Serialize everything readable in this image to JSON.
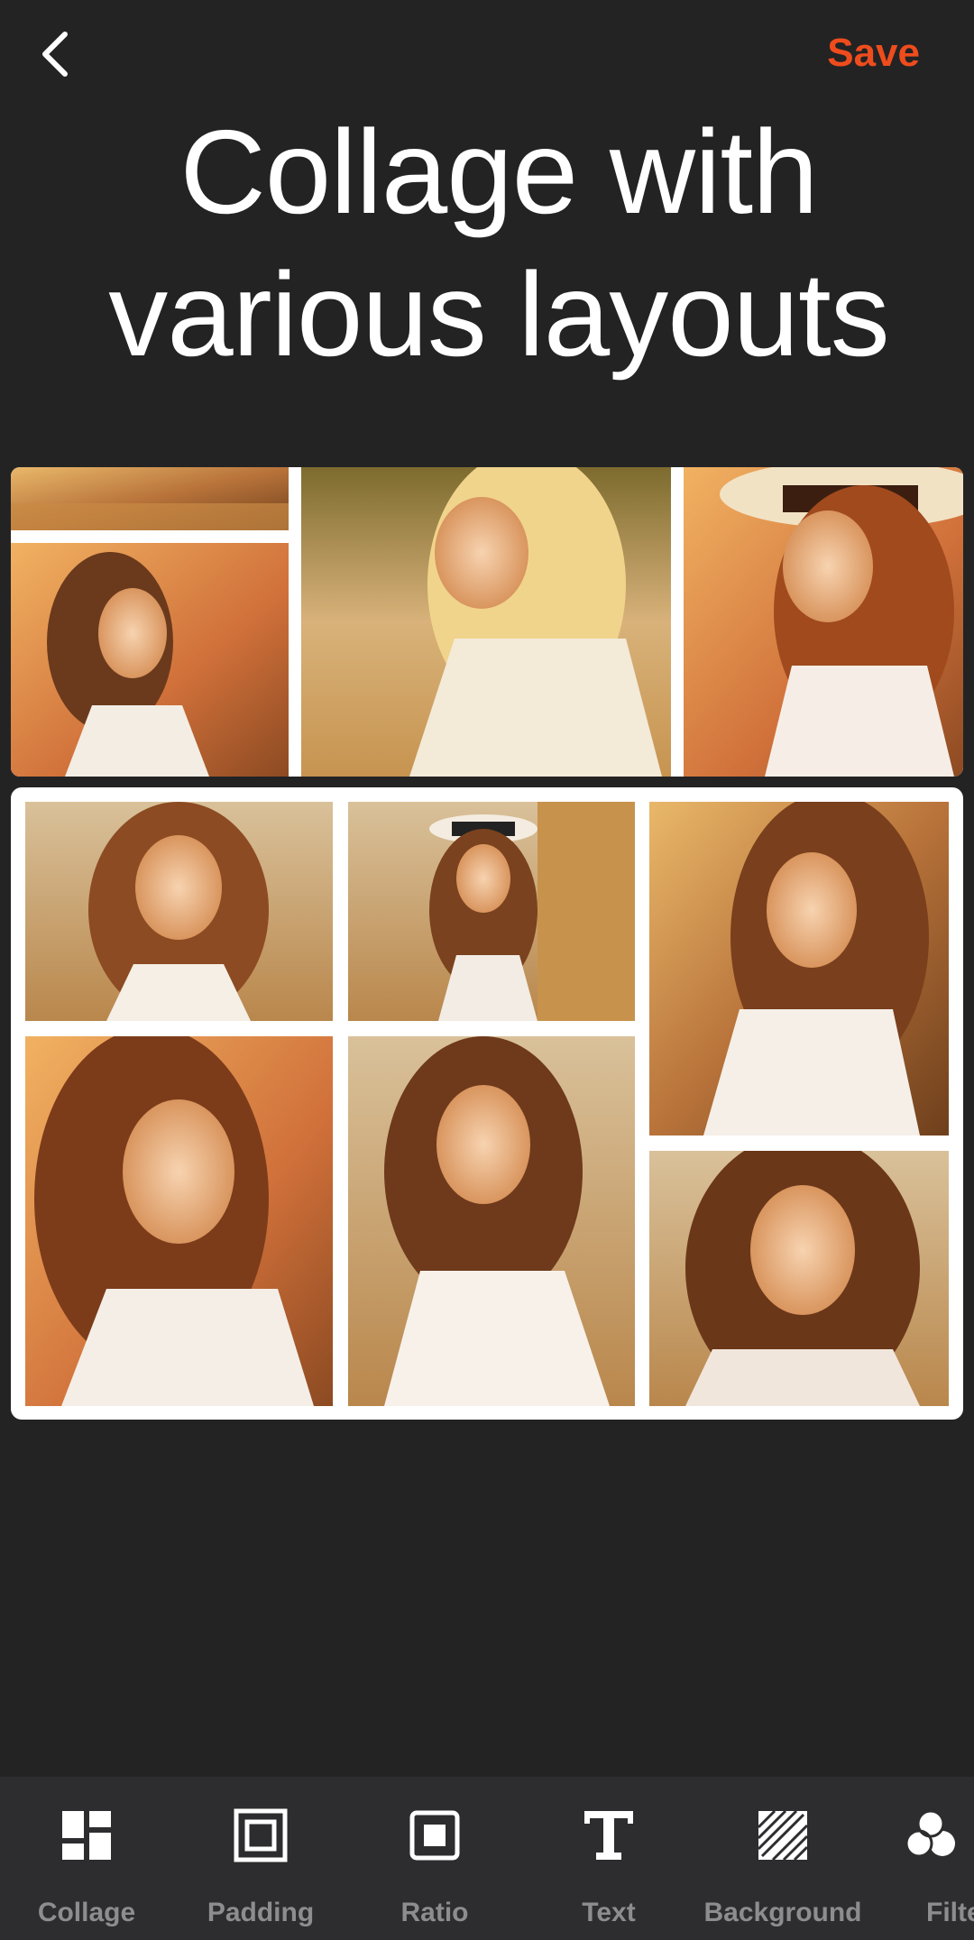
{
  "header": {
    "back_icon": "chevron-left-icon",
    "save_label": "Save",
    "title_line1": "Collage with",
    "title_line2": "various layouts"
  },
  "colors": {
    "accent": "#ef4c1d",
    "background": "#232324",
    "toolbar_bg": "#2d2d2f",
    "toolbar_label": "#8d8d90"
  },
  "toolbar": {
    "items": [
      {
        "label": "Collage",
        "icon": "collage-layout-icon"
      },
      {
        "label": "Padding",
        "icon": "padding-frame-icon"
      },
      {
        "label": "Ratio",
        "icon": "ratio-square-icon"
      },
      {
        "label": "Text",
        "icon": "text-t-icon"
      },
      {
        "label": "Background",
        "icon": "background-hatch-icon"
      },
      {
        "label": "Filte",
        "icon": "filter-circles-icon"
      }
    ]
  }
}
